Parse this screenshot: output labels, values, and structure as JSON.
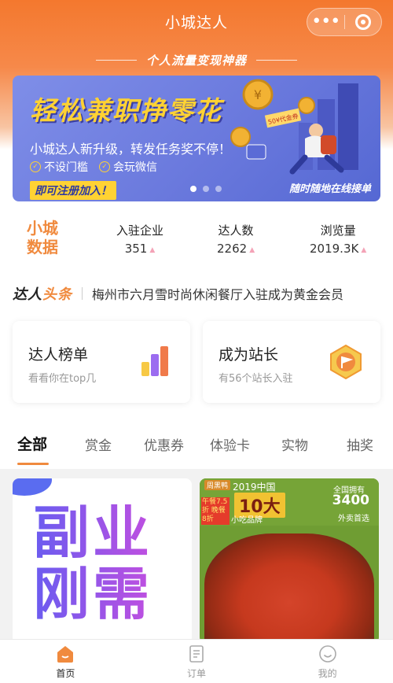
{
  "app": {
    "title": "小城达人",
    "slogan": "个人流量变现神器"
  },
  "banner": {
    "title": "轻松兼职挣零花",
    "subtitle": "小城达人新升级，转发任务奖不停！",
    "features": [
      "不设门槛",
      "会玩微信"
    ],
    "cta": "即可注册加入！",
    "tagline": "随时随地在线接单",
    "ticket": "50¥代金券",
    "slide_count": 3,
    "active_slide": 0
  },
  "stats": {
    "brand": [
      "小城",
      "数据"
    ],
    "items": [
      {
        "label": "入驻企业",
        "value": "351"
      },
      {
        "label": "达人数",
        "value": "2262"
      },
      {
        "label": "浏览量",
        "value": "2019.3K"
      }
    ]
  },
  "headline": {
    "logo_a": "达人",
    "logo_b": "头条",
    "text": "梅州市六月雪时尚休闲餐厅入驻成为黄金会员"
  },
  "cards": [
    {
      "title": "达人榜单",
      "subtitle": "看看你在top几"
    },
    {
      "title": "成为站长",
      "subtitle": "有56个站长入驻"
    }
  ],
  "tabs": [
    "全部",
    "赏金",
    "优惠券",
    "体验卡",
    "实物",
    "抽奖"
  ],
  "active_tab": 0,
  "feed": {
    "left": {
      "line1": "副业",
      "line2": "刚需"
    },
    "right": {
      "badge": "周黑鸭",
      "year": "2019中国",
      "ten": "10大",
      "cert": "小吃品牌",
      "offer": "午餐7.5折 晚餐8折",
      "label": "全国拥有",
      "num": "3400",
      "foot": "外卖首选"
    }
  },
  "nav": [
    {
      "label": "首页",
      "icon": "home-icon"
    },
    {
      "label": "订单",
      "icon": "order-icon"
    },
    {
      "label": "我的",
      "icon": "profile-icon"
    }
  ],
  "colors": {
    "accent": "#f08a3e",
    "header": "#f4782e",
    "banner": "#6a79dd"
  }
}
